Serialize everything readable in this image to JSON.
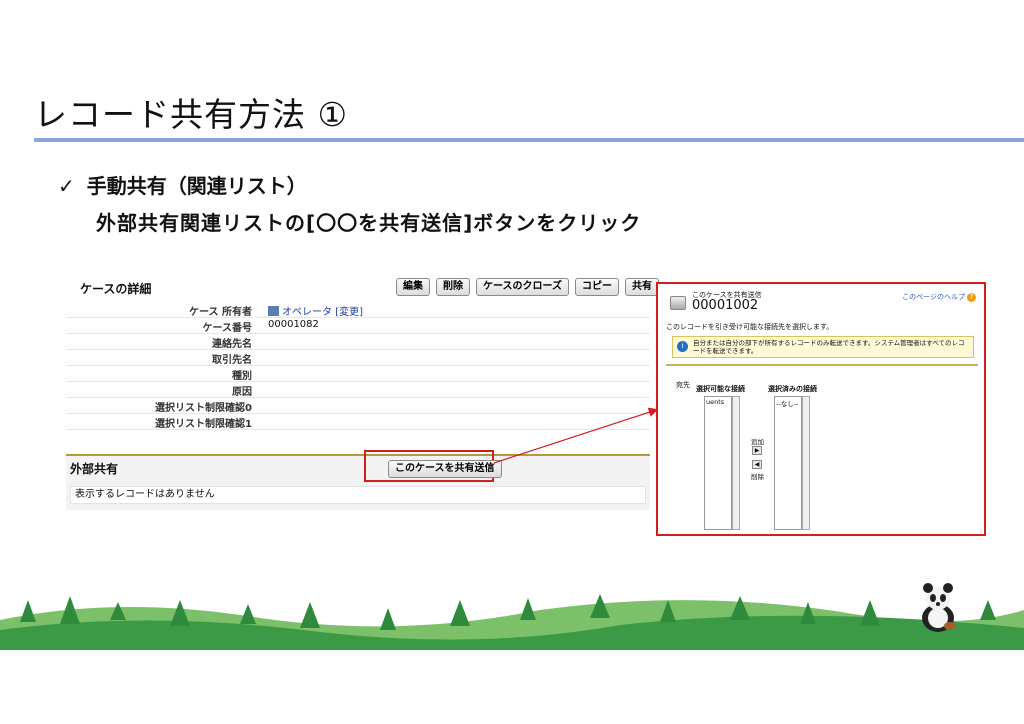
{
  "slide": {
    "title": "レコード共有方法 ①",
    "bullet_check": "✓",
    "bullet": "手動共有（関連リスト）",
    "subtext": "外部共有関連リストの[〇〇を共有送信]ボタンをクリック"
  },
  "case_detail": {
    "header": "ケースの詳細",
    "buttons": [
      "編集",
      "削除",
      "ケースのクローズ",
      "コピー",
      "共有"
    ],
    "fields": [
      {
        "label": "ケース 所有者",
        "value": "オペレータ",
        "extra": "[変更]"
      },
      {
        "label": "ケース番号",
        "value": "00001082"
      },
      {
        "label": "連絡先名",
        "value": ""
      },
      {
        "label": "取引先名",
        "value": ""
      },
      {
        "label": "種別",
        "value": ""
      },
      {
        "label": "原因",
        "value": ""
      },
      {
        "label": "選択リスト制限確認0",
        "value": ""
      },
      {
        "label": "選択リスト制限確認1",
        "value": ""
      }
    ]
  },
  "external_sharing": {
    "title": "外部共有",
    "button": "このケースを共有送信",
    "empty_message": "表示するレコードはありません"
  },
  "dialog": {
    "subtitle": "このケースを共有送信",
    "record_number": "00001002",
    "help_link": "このページのヘルプ",
    "help_icon": "?",
    "instruction": "このレコードを引き受け可能な接続先を選択します。",
    "info_icon": "i",
    "info": "自分または自分の部下が所有するレコードのみ転送できます。システム管理者はすべてのレコードを転送できます。",
    "recipient_label": "宛先",
    "available_label": "選択可能な接続",
    "selected_label": "選択済みの接続",
    "available_items": [
      "uents"
    ],
    "selected_items": [
      "--なし--"
    ],
    "add_label": "追加",
    "remove_label": "削除"
  },
  "colors": {
    "title_rule": "#8ea6d6",
    "highlight": "#d21e1e",
    "link": "#1a3fa0"
  }
}
